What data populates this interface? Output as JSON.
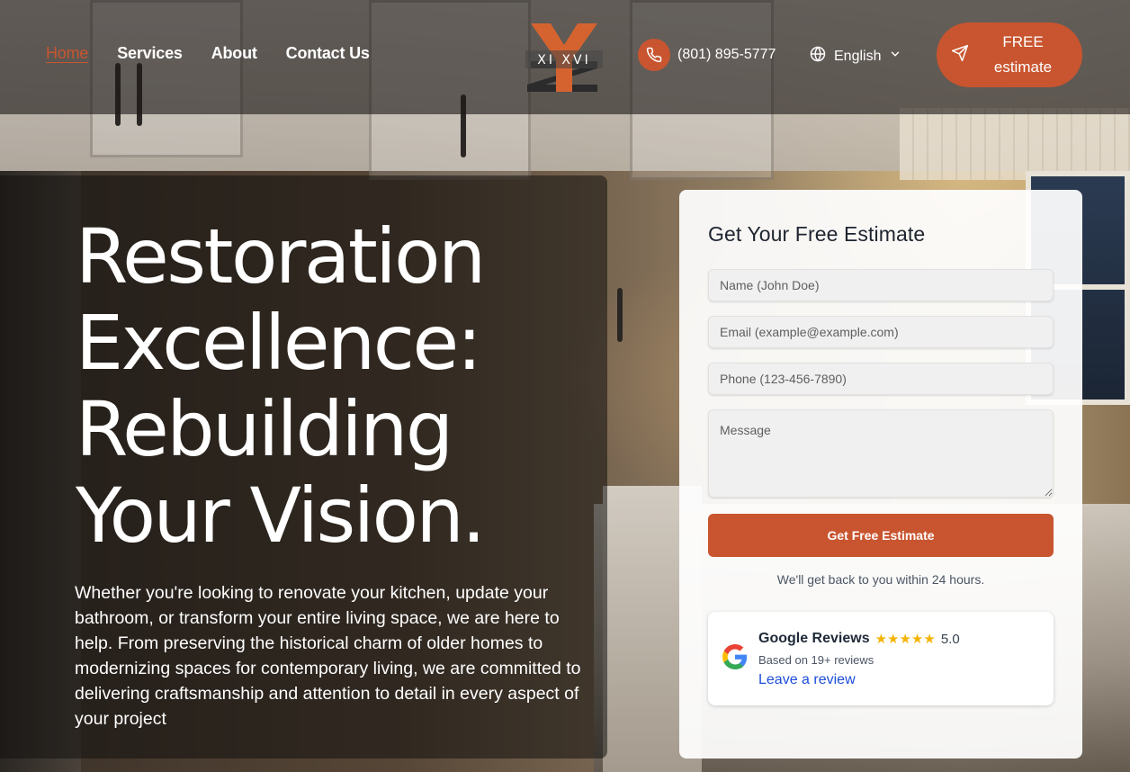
{
  "nav": {
    "items": [
      {
        "label": "Home",
        "active": true
      },
      {
        "label": "Services",
        "active": false
      },
      {
        "label": "About",
        "active": false
      },
      {
        "label": "Contact Us",
        "active": false
      }
    ]
  },
  "logo": {
    "text": "XI XVI"
  },
  "contact": {
    "phone": "(801) 895-5777",
    "icon": "phone-icon"
  },
  "language": {
    "selected": "English",
    "icon": "globe-icon"
  },
  "cta": {
    "label": "FREE estimate",
    "icon": "send-icon"
  },
  "hero": {
    "title": "Restoration Excellence: Rebuilding Your Vision.",
    "text": "Whether you're looking to renovate your kitchen, update your bathroom, or transform your entire living space, we are here to help. From preserving the historical charm of older homes to modernizing spaces for contemporary living, we are committed to delivering craftsmanship and attention to detail in every aspect of your project"
  },
  "form": {
    "title": "Get Your Free Estimate",
    "name_placeholder": "Name (John Doe)",
    "email_placeholder": "Email (example@example.com)",
    "phone_placeholder": "Phone (123-456-7890)",
    "message_placeholder": "Message",
    "submit_label": "Get Free Estimate",
    "note": "We'll get back to you within 24 hours."
  },
  "reviews": {
    "title": "Google Reviews",
    "stars": "★★★★★",
    "rating": "5.0",
    "subtitle": "Based on 19+ reviews",
    "link": "Leave a review",
    "icon": "google-icon"
  },
  "colors": {
    "accent": "#c8552f",
    "link": "#1d4ed8",
    "star": "#f4b400"
  }
}
